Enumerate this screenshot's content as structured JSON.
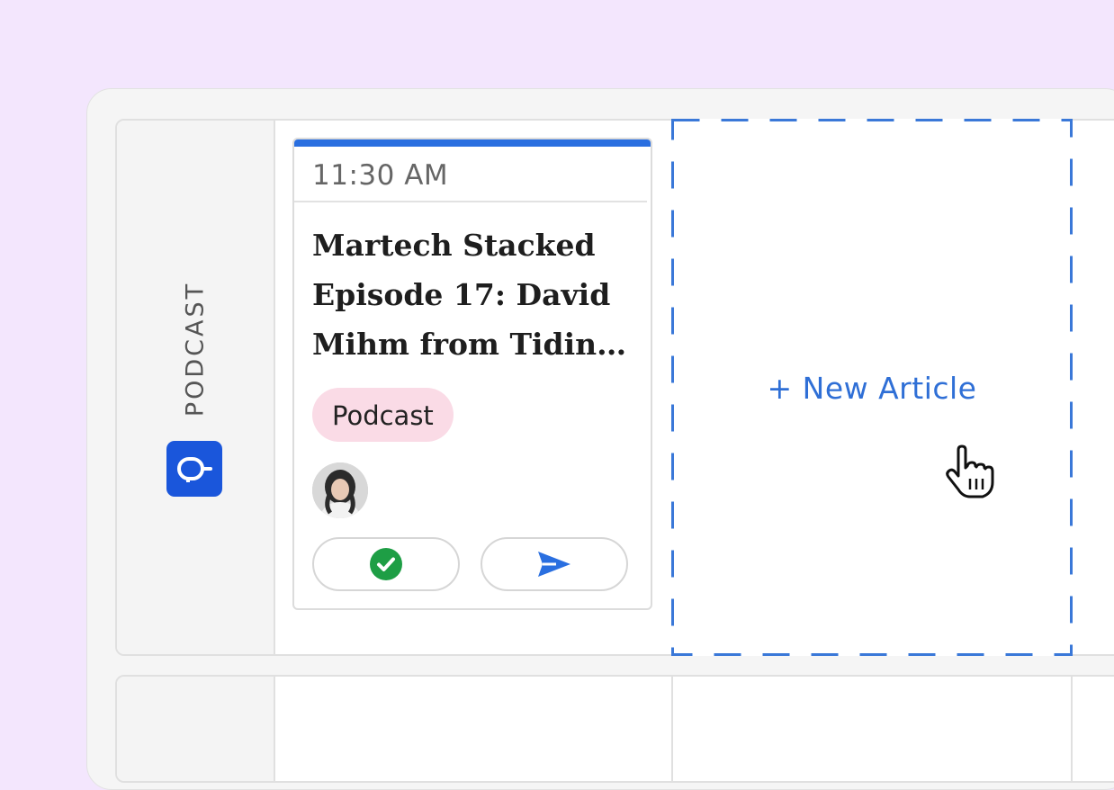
{
  "row": {
    "label": "PODCAST",
    "icon": "microphone-icon"
  },
  "card": {
    "time": "11:30 AM",
    "title": "Martech Stacked Episode 17: David Mihm from Tidin…",
    "tag": "Podcast",
    "avatar": "author-avatar",
    "actions": {
      "approve_icon": "check-circle-icon",
      "send_icon": "send-icon"
    }
  },
  "dropzone": {
    "label": "+ New Article"
  },
  "colors": {
    "accent": "#2a6fe0",
    "badge": "#1a56db",
    "tag_bg": "#fadbe6",
    "approve": "#1e9e45",
    "background": "#f3e6fd"
  }
}
